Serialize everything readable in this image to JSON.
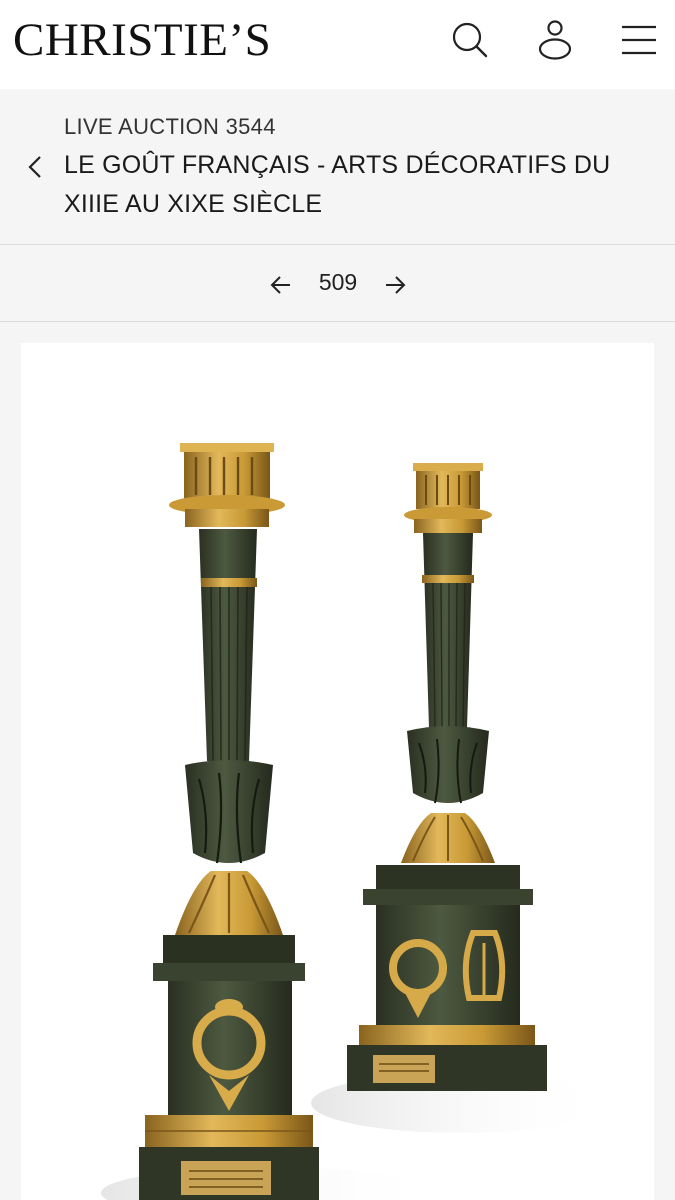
{
  "header": {
    "logo_text": "CHRISTIE’S",
    "icons": [
      "search-icon",
      "account-icon",
      "menu-icon"
    ]
  },
  "sale": {
    "type_label": "LIVE AUCTION 3544",
    "title": "LE GOÛT FRANÇAIS - ARTS DÉCORATIFS DU XIIIE AU XIXE SIÈCLE"
  },
  "lot_nav": {
    "lot_number": "509"
  },
  "image": {
    "subject": "pair of patinated and gilt bronze candlesticks"
  },
  "colors": {
    "bronze_patina": "#3c4530",
    "gilt": "#c99a36",
    "background": "#f5f5f5"
  }
}
